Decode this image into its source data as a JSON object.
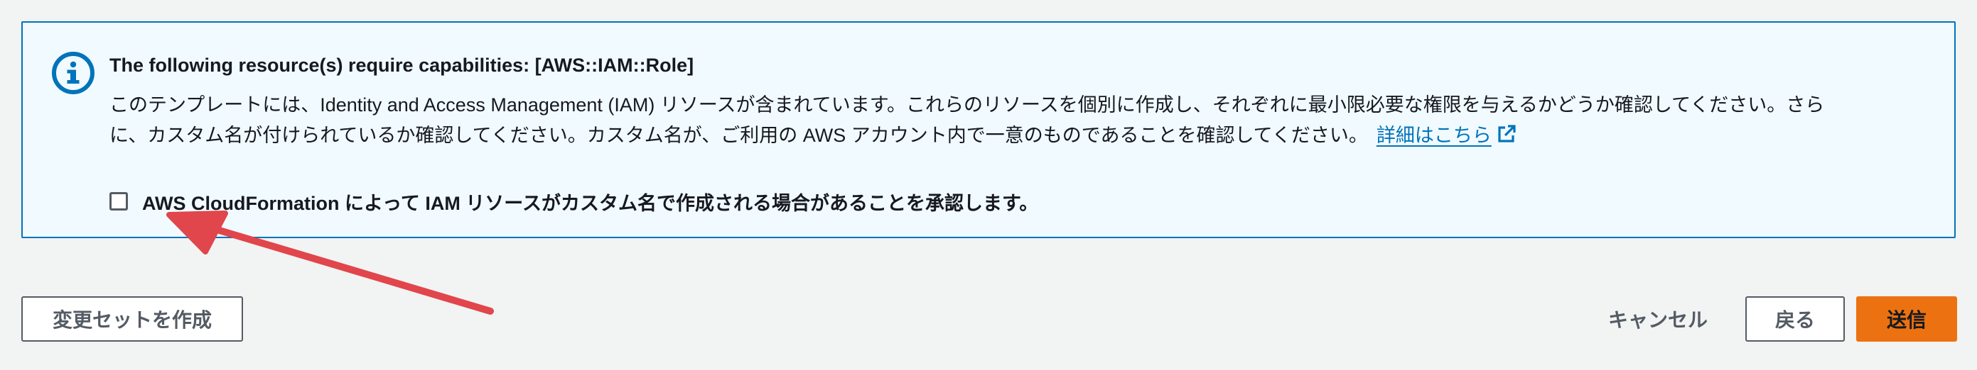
{
  "alert": {
    "title": "The following resource(s) require capabilities: [AWS::IAM::Role]",
    "body_line1": "このテンプレートには、Identity and Access Management (IAM) リソースが含まれています。これらのリソースを個別に作成し、それぞれに最小限必要な権限を与えるかどうか確認してください。さら",
    "body_line2": "に、カスタム名が付けられているか確認してください。カスタム名が、ご利用の AWS アカウント内で一意のものであることを確認してください。",
    "learn_more_link": "詳細はこちら",
    "acknowledge_label": "AWS CloudFormation によって IAM リソースがカスタム名で作成される場合があることを承認します。",
    "acknowledge_checked": false,
    "info_icon": "info-icon",
    "external_link_icon": "external-link-icon",
    "accent_color": "#0073bb"
  },
  "annotation": {
    "arrow_color": "#e0464b"
  },
  "footer": {
    "create_change_set_label": "変更セットを作成",
    "cancel_label": "キャンセル",
    "back_label": "戻る",
    "submit_label": "送信",
    "submit_color": "#ec7211"
  }
}
